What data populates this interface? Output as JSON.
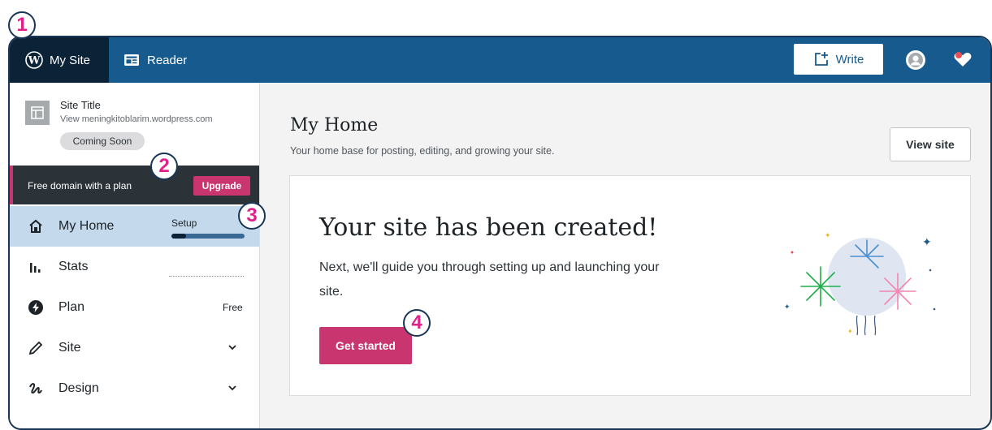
{
  "topbar": {
    "my_site_label": "My Site",
    "reader_label": "Reader",
    "write_label": "Write",
    "icons": {
      "wordpress": "wordpress-logo-icon",
      "reader": "reader-icon",
      "write": "write-icon",
      "avatar": "user-avatar-icon",
      "notifications": "notifications-heart-icon"
    }
  },
  "sidebar": {
    "site_title": "Site Title",
    "site_url": "View meningkitoblarim.wordpress.com",
    "coming_soon_badge": "Coming Soon",
    "upsell_text": "Free domain with a plan",
    "upgrade_label": "Upgrade",
    "items": [
      {
        "label": "My Home",
        "icon": "home-icon",
        "badge": "Setup",
        "progress": 0.2
      },
      {
        "label": "Stats",
        "icon": "stats-icon"
      },
      {
        "label": "Plan",
        "icon": "plan-icon",
        "badge": "Free"
      },
      {
        "label": "Site",
        "icon": "pencil-icon"
      },
      {
        "label": "Design",
        "icon": "design-icon"
      }
    ]
  },
  "main": {
    "title": "My Home",
    "subtitle": "Your home base for posting, editing, and growing your site.",
    "view_site_label": "View site",
    "card": {
      "title": "Your site has been created!",
      "text": "Next, we'll guide you through setting up and launching your site.",
      "button_label": "Get started"
    }
  },
  "callouts": [
    "1",
    "2",
    "3",
    "4"
  ],
  "colors": {
    "topbar": "#175a8e",
    "accent": "#c9356e",
    "callout": "#e0218a",
    "selected_nav": "#c5d9ed"
  }
}
